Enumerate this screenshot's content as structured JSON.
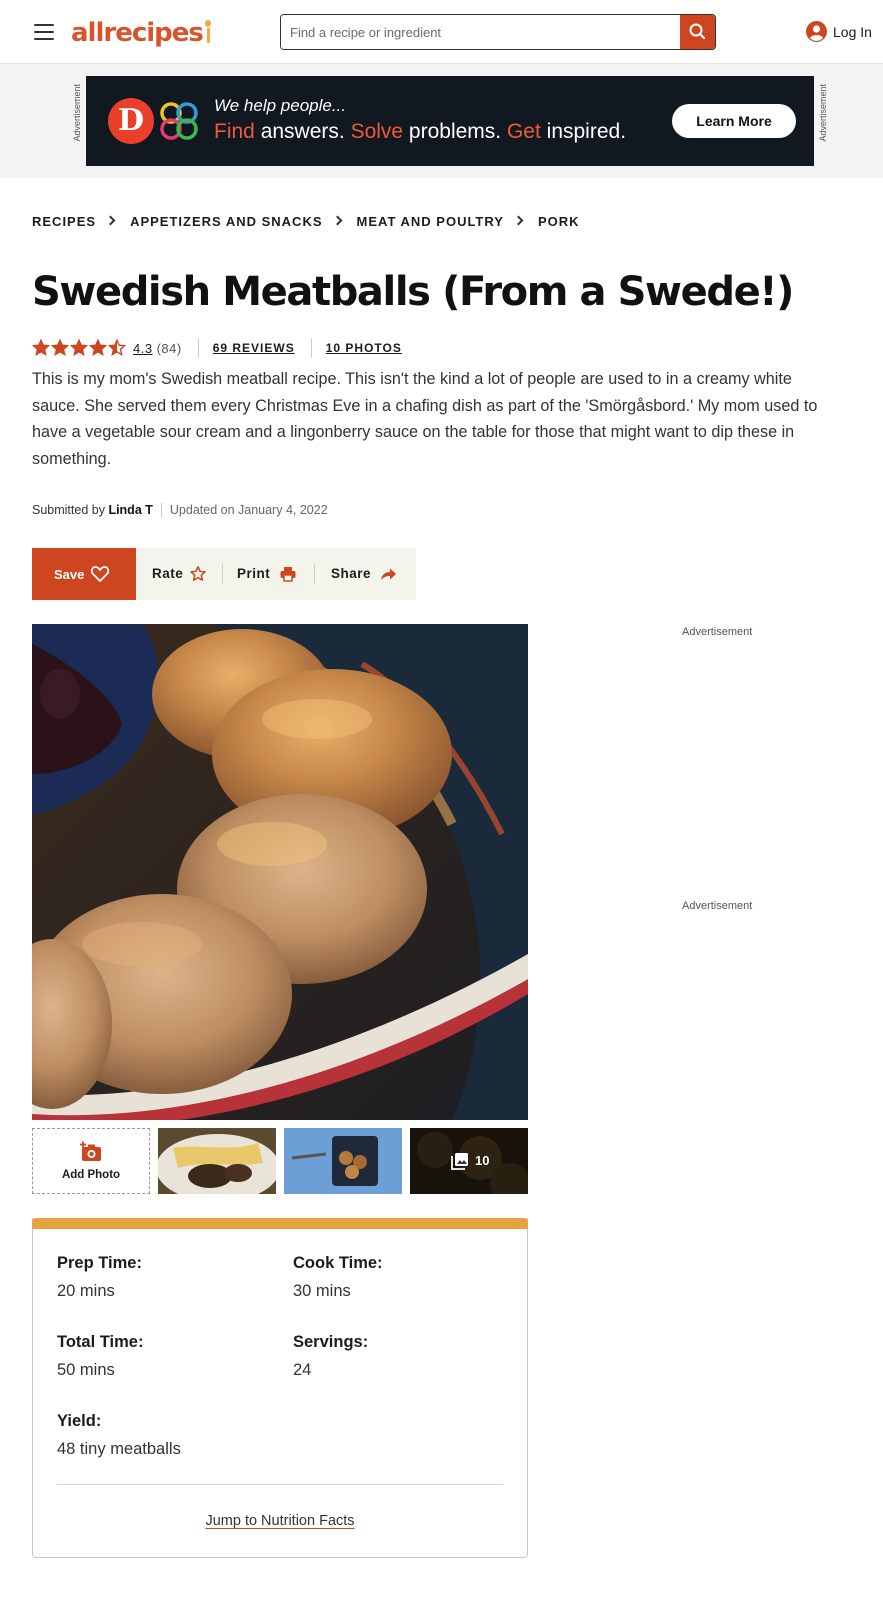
{
  "header": {
    "logo_text": "allrecipes",
    "search": {
      "placeholder": "Find a recipe or ingredient"
    },
    "login_label": "Log In"
  },
  "ad_banner": {
    "side_label": "Advertisement",
    "tagline": "We help people...",
    "line_parts": [
      "Find",
      " answers. ",
      "Solve",
      " problems. ",
      "Get",
      " inspired."
    ],
    "cta": "Learn More"
  },
  "breadcrumb": [
    "RECIPES",
    "APPETIZERS AND SNACKS",
    "MEAT AND POULTRY",
    "PORK"
  ],
  "recipe": {
    "title": "Swedish Meatballs (From a Swede!)",
    "rating": {
      "value": "4.3",
      "count": "(84)",
      "stars_value": 4.3,
      "reviews_link": "69 REVIEWS",
      "photos_link": "10 PHOTOS"
    },
    "description": "This is my mom's Swedish meatball recipe. This isn't the kind a lot of people are used to in a creamy white sauce. She served them every Christmas Eve in a chafing dish as part of the 'Smörgåsbord.' My mom used to have a vegetable sour cream and a lingonberry sauce on the table for those that might want to dip these in something.",
    "byline": {
      "prefix": "Submitted by ",
      "author": "Linda T",
      "updated": "Updated on January 4, 2022"
    }
  },
  "actions": {
    "save": "Save",
    "rate": "Rate",
    "print": "Print",
    "share": "Share"
  },
  "gallery": {
    "add_photo_label": "Add Photo",
    "more_count": "10"
  },
  "side_ads": [
    "Advertisement",
    "Advertisement"
  ],
  "details": {
    "prep_label": "Prep Time:",
    "prep_value": "20 mins",
    "cook_label": "Cook Time:",
    "cook_value": "30 mins",
    "total_label": "Total Time:",
    "total_value": "50 mins",
    "servings_label": "Servings:",
    "servings_value": "24",
    "yield_label": "Yield:",
    "yield_value": "48 tiny meatballs",
    "jump_link": "Jump to Nutrition Facts"
  },
  "colors": {
    "brand": "#ce4620",
    "accent_bar": "#e5a43f",
    "action_bar_bg": "#f3f4eb",
    "ad_bg": "#11181f"
  },
  "icons": [
    "menu-icon",
    "search-icon",
    "user-icon",
    "chevron-right-icon",
    "star-icon",
    "heart-icon",
    "star-outline-icon",
    "printer-icon",
    "share-arrow-icon",
    "camera-plus-icon",
    "gallery-icon"
  ]
}
